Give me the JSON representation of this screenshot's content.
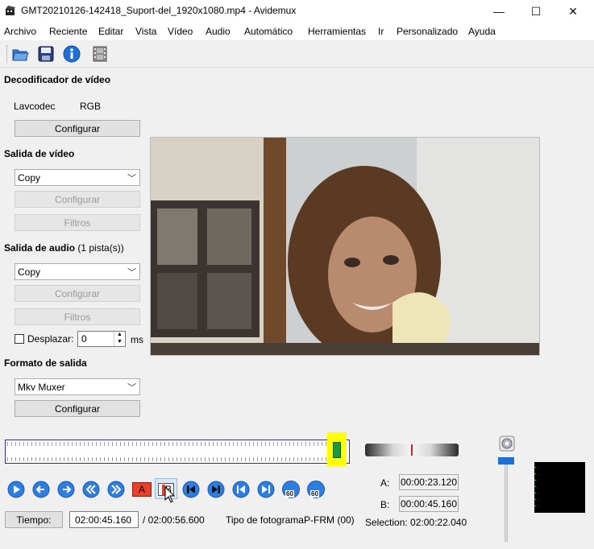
{
  "window": {
    "title": "GMT20210126-142418_Suport-del_1920x1080.mp4 - Avidemux",
    "minimize": "—",
    "maximize": "☐",
    "close": "✕"
  },
  "menu": [
    "Archivo",
    "Reciente",
    "Editar",
    "Vista",
    "Vídeo",
    "Audio",
    "Automático",
    "Herramientas",
    "Ir",
    "Personalizado",
    "Ayuda"
  ],
  "toolbar": {
    "icons": [
      "open-folder-icon",
      "save-disk-icon",
      "info-icon",
      "film-icon"
    ]
  },
  "video_decoder": {
    "title": "Decodificador de vídeo",
    "codec": "Lavcodec",
    "colorspace": "RGB",
    "configure": "Configurar"
  },
  "video_output": {
    "title": "Salida de vídeo",
    "selected": "Copy",
    "configure": "Configurar",
    "filters": "Filtros"
  },
  "audio_output": {
    "title": "Salida de audio",
    "tracks": "(1 pista(s))",
    "selected": "Copy",
    "configure": "Configurar",
    "filters": "Filtros",
    "shift_label": "Desplazar:",
    "shift_value": "0",
    "shift_unit": "ms"
  },
  "output_format": {
    "title": "Formato de salida",
    "selected": "Mkv Muxer",
    "configure": "Configurar"
  },
  "playback": {
    "progress": 0.99,
    "controls": [
      "play",
      "back-one-frame",
      "forward-one-frame",
      "back-keyframe",
      "forward-keyframe",
      "set-marker-a",
      "set-marker-b",
      "go-to-previous-cut",
      "go-to-next-cut",
      "go-to-marker-a",
      "go-to-marker-b",
      "back-60s",
      "forward-60s"
    ],
    "marker_a_glyph": "A",
    "marker_b_glyph": "B",
    "back60": "60",
    "fwd60": "60"
  },
  "markers": {
    "a_label": "A:",
    "a_value": "00:00:23.120",
    "b_label": "B:",
    "b_value": "00:00:45.160",
    "selection_label": "Selection:",
    "selection_value": "02:00:22.040"
  },
  "time": {
    "button": "Tiempo:",
    "current": "02:00:45.160",
    "total": "/ 02:00:56.600",
    "frame_type_label": "Tipo de fotograma:",
    "frame_type_value": "P-FRM (00)"
  },
  "colors": {
    "accent": "#1e6fd6",
    "timeline_border": "#2d2d8a",
    "cursor_highlight": "#ffff00",
    "cursor_fill": "#1a9a3a"
  }
}
